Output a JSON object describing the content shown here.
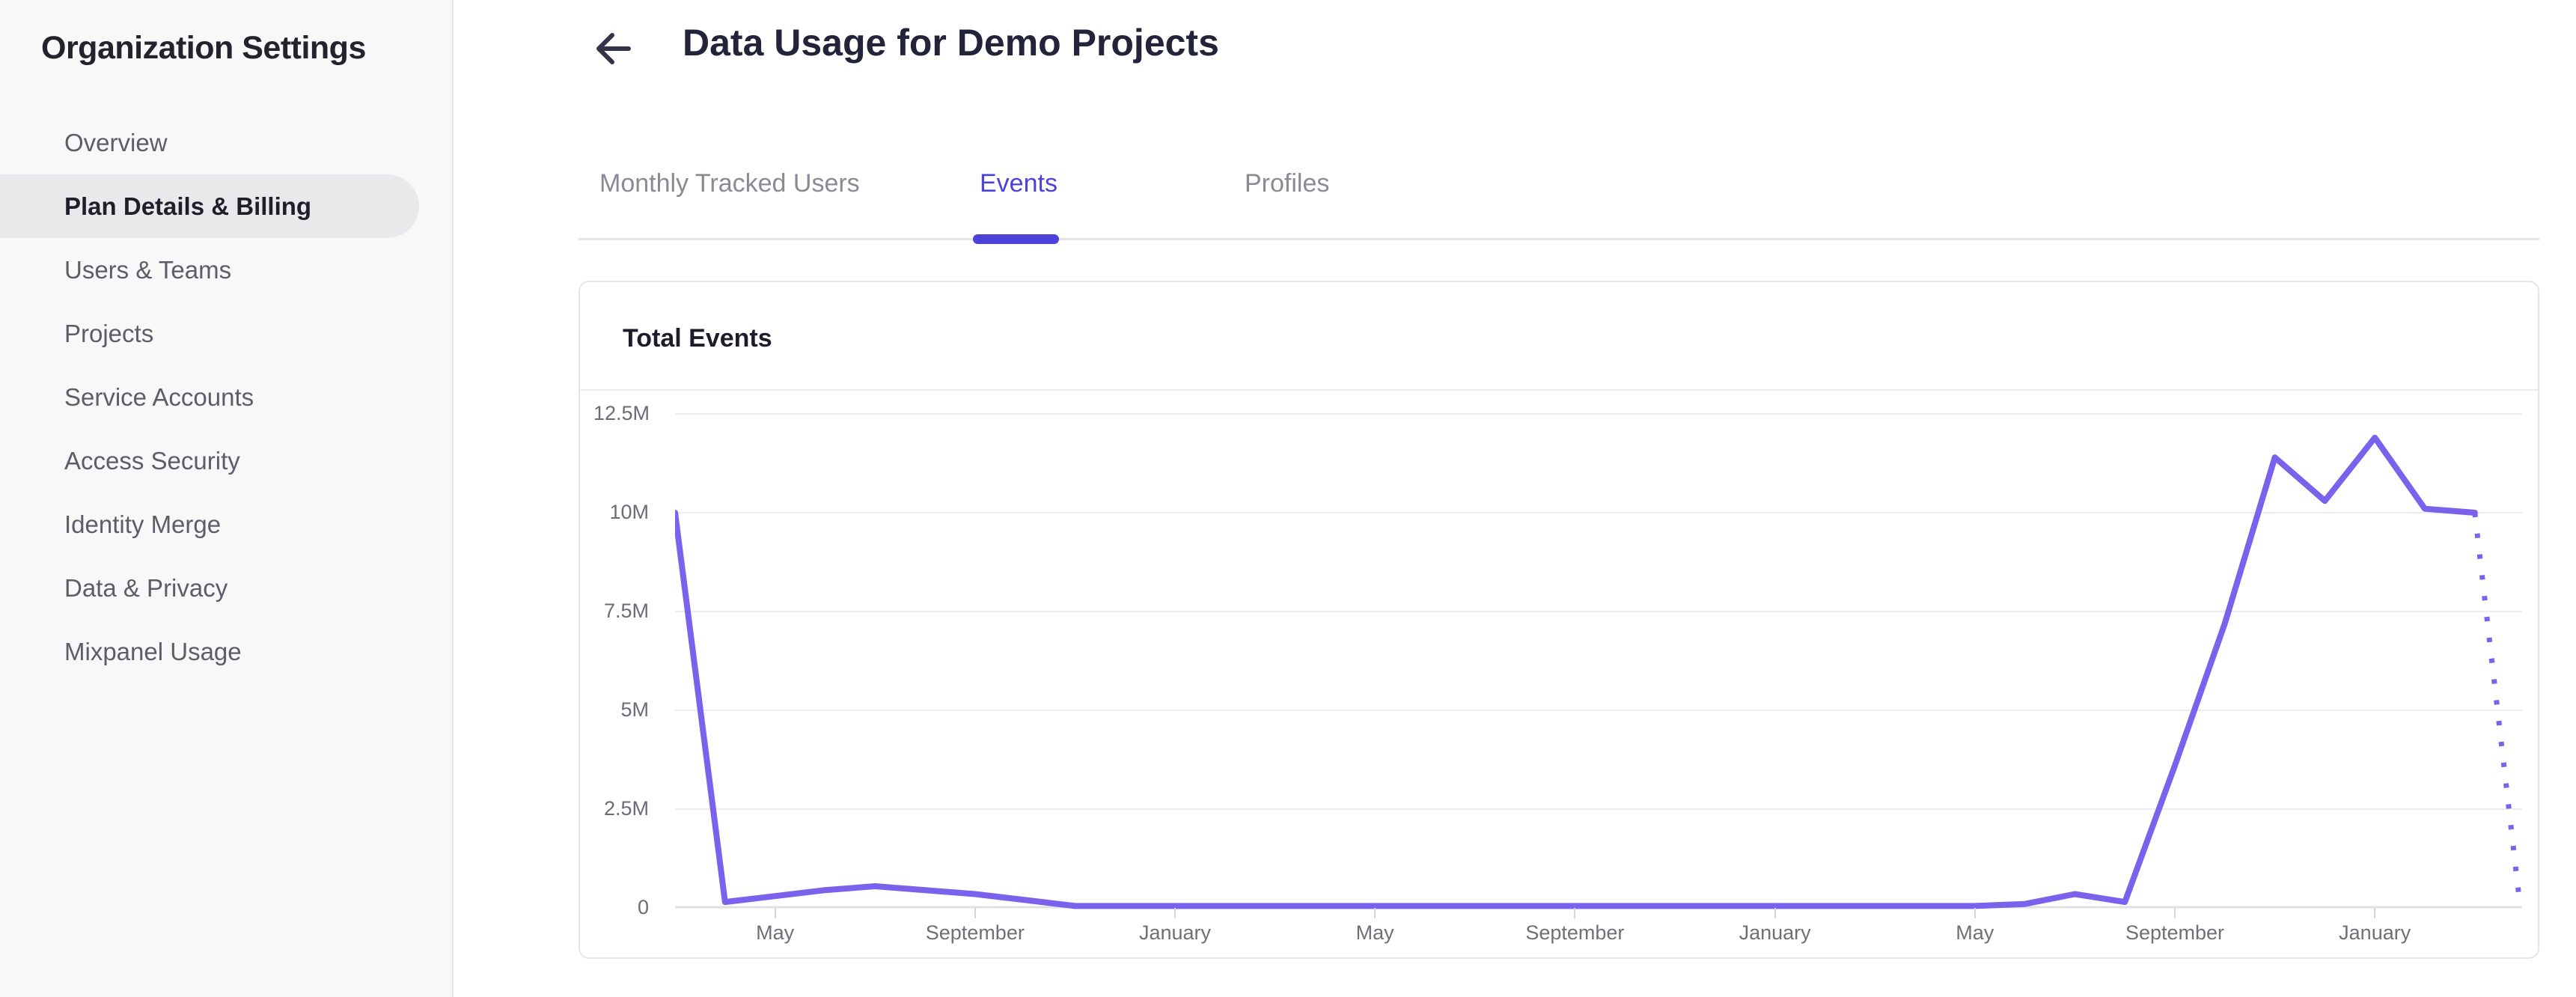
{
  "sidebar": {
    "title": "Organization Settings",
    "items": [
      {
        "label": "Overview",
        "active": false
      },
      {
        "label": "Plan Details & Billing",
        "active": true
      },
      {
        "label": "Users & Teams",
        "active": false
      },
      {
        "label": "Projects",
        "active": false
      },
      {
        "label": "Service Accounts",
        "active": false
      },
      {
        "label": "Access Security",
        "active": false
      },
      {
        "label": "Identity Merge",
        "active": false
      },
      {
        "label": "Data & Privacy",
        "active": false
      },
      {
        "label": "Mixpanel Usage",
        "active": false
      }
    ]
  },
  "header": {
    "title": "Data Usage for Demo Projects",
    "back_icon": "left-arrow"
  },
  "tabs": {
    "items": [
      {
        "label": "Monthly Tracked Users",
        "active": false
      },
      {
        "label": "Events",
        "active": true
      },
      {
        "label": "Profiles",
        "active": false
      }
    ]
  },
  "card": {
    "title": "Total Events"
  },
  "theme": {
    "accent": "#4c42da",
    "line_color": "#7a62ec",
    "sidebar_active_bg": "#e9e9ec"
  },
  "chart_data": {
    "type": "line",
    "title": "Total Events",
    "xlabel": "",
    "ylabel": "",
    "ylim_millions": [
      0,
      12.5
    ],
    "y_tick_labels": [
      "12.5M",
      "10M",
      "7.5M",
      "5M",
      "2.5M",
      "0"
    ],
    "x_tick_labels": [
      "May",
      "September",
      "January",
      "May",
      "September",
      "January",
      "May",
      "September",
      "January"
    ],
    "x_tick_month_indices": [
      2,
      6,
      10,
      14,
      18,
      22,
      26,
      30,
      34
    ],
    "grid": "horizontal gridlines only",
    "legend": "none",
    "series": [
      {
        "name": "Total Events",
        "color": "#7a62ec",
        "style": "solid line; final point drawn as dotted projection",
        "points_millions": [
          10,
          0.15,
          0.3,
          0.45,
          0.55,
          0.45,
          0.35,
          0.2,
          0.05,
          0.05,
          0.05,
          0.05,
          0.05,
          0.05,
          0.05,
          0.05,
          0.05,
          0.05,
          0.05,
          0.05,
          0.05,
          0.05,
          0.05,
          0.05,
          0.05,
          0.05,
          0.05,
          0.1,
          0.35,
          0.15,
          3.6,
          7.2,
          11.4,
          10.3,
          11.9,
          10.1,
          10,
          0.1
        ],
        "projected_point_count": 1
      }
    ]
  }
}
